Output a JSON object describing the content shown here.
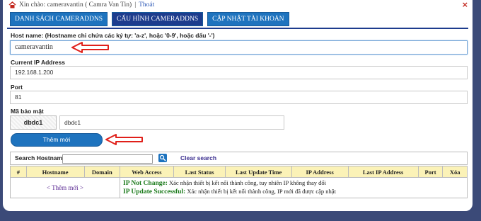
{
  "header": {
    "greeting": "Xin chào: cameravantin ( Camra Van Tin)",
    "separator": " | ",
    "logout": "Thoát",
    "close": "×"
  },
  "tabs": [
    {
      "label": "DANH SÁCH CAMERADDNS",
      "active": false
    },
    {
      "label": "CẤU HÌNH CAMERADDNS",
      "active": true
    },
    {
      "label": "CẬP NHẬT TÀI KHOẢN",
      "active": false
    }
  ],
  "form": {
    "hostname_label": "Host name: (Hostname chỉ chứa các ký tự: 'a-z', hoặc '0-9', hoặc dấu '-')",
    "hostname_value": "cameravantin",
    "ip_label": "Current IP Address",
    "ip_value": "192.168.1.200",
    "port_label": "Port",
    "port_value": "81",
    "security_label": "Mã bảo mật",
    "captcha_text": "dbdc1",
    "captcha_value": "dbdc1",
    "submit_label": "Thêm mới"
  },
  "search": {
    "label": "Search Hostname:",
    "value": "",
    "clear_label": "Clear search"
  },
  "table": {
    "headers": [
      "#",
      "Hostname",
      "Domain",
      "Web Access",
      "Last Status",
      "Last Update Time",
      "IP Address",
      "Last IP Address",
      "Port",
      "Xóa"
    ],
    "add_new": "< Thêm mới >",
    "legend": [
      {
        "key": "IP Not Change:",
        "text": " Xác nhận thiết bị kết nối thành công, tuy nhiên IP không thay đổi"
      },
      {
        "key": "IP Update Successful:",
        "text": " Xác nhận thiết bị kết nối thành công, IP mới đã được cập nhật"
      }
    ]
  },
  "colors": {
    "tab_blue": "#1e73be",
    "tab_active": "#1d3c8d",
    "header_row": "#fbf2b7",
    "arrow_red": "#e0201a",
    "legend_green": "#1a7a1a"
  }
}
